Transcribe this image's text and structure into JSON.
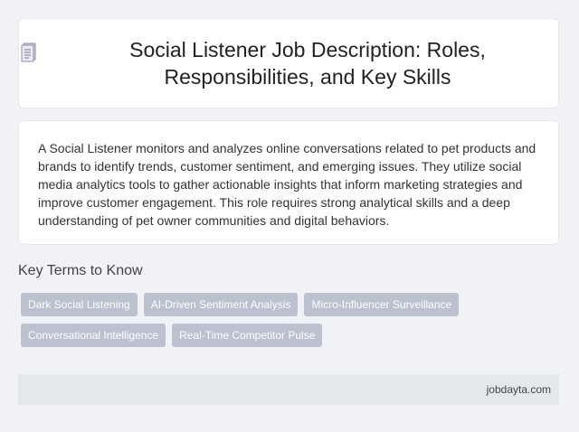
{
  "header": {
    "icon": "document-icon",
    "title": "Social Listener Job Description: Roles, Responsibilities, and Key Skills"
  },
  "description": "A Social Listener monitors and analyzes online conversations related to pet products and brands to identify trends, customer sentiment, and emerging issues. They utilize social media analytics tools to gather actionable insights that inform marketing strategies and improve customer engagement. This role requires strong analytical skills and a deep understanding of pet owner communities and digital behaviors.",
  "key_terms": {
    "heading": "Key Terms to Know",
    "items": [
      "Dark Social Listening",
      "AI-Driven Sentiment Analysis",
      "Micro-Influencer Surveillance",
      "Conversational Intelligence",
      "Real-Time Competitor Pulse"
    ]
  },
  "footer": {
    "source": "jobdayta.com"
  },
  "colors": {
    "background": "#f0f2f5",
    "card": "#ffffff",
    "tag": "#bcc1cf",
    "footer": "#e4e8ec"
  }
}
